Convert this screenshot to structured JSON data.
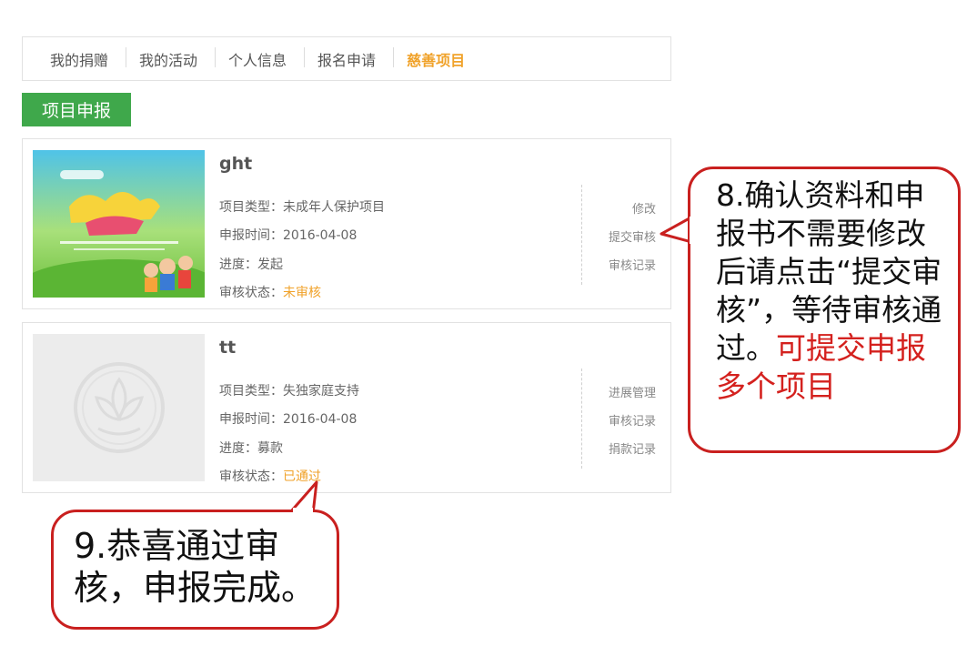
{
  "tabs": [
    {
      "label": "我的捐赠"
    },
    {
      "label": "我的活动"
    },
    {
      "label": "个人信息"
    },
    {
      "label": "报名申请"
    },
    {
      "label": "慈善项目"
    }
  ],
  "apply_button": "项目申报",
  "projects": [
    {
      "title": "ght",
      "type_label": "项目类型：",
      "type_value": "未成年人保护项目",
      "date_label": "申报时间：",
      "date_value": "2016-04-08",
      "progress_label": "进度：",
      "progress_value": "发起",
      "status_label": "审核状态：",
      "status_value": "未审核",
      "actions": [
        "修改",
        "提交审核",
        "审核记录"
      ]
    },
    {
      "title": "tt",
      "type_label": "项目类型：",
      "type_value": "失独家庭支持",
      "date_label": "申报时间：",
      "date_value": "2016-04-08",
      "progress_label": "进度：",
      "progress_value": "募款",
      "status_label": "审核状态：",
      "status_value": "已通过",
      "actions": [
        "进展管理",
        "审核记录",
        "捐款记录"
      ]
    }
  ],
  "callouts": {
    "step8_text": "8.确认资料和申报书不需要修改后请点击“提交审核”，等待审核通过。",
    "step8_red": "可提交申报多个项目",
    "step9_text": "9.恭喜通过审核，申报完成。"
  },
  "colors": {
    "green": "#3fa84b",
    "orange": "#f0a22a",
    "red": "#c9201f"
  }
}
